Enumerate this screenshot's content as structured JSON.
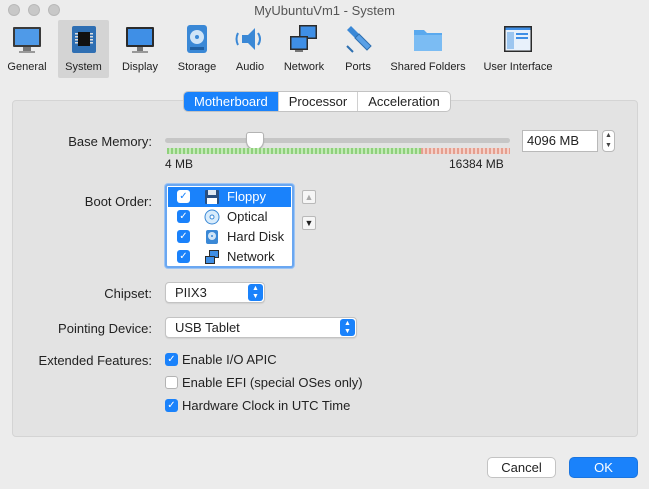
{
  "window": {
    "title": "MyUbuntuVm1 - System"
  },
  "toolbar": {
    "items": [
      {
        "label": "General",
        "icon": "general-icon"
      },
      {
        "label": "System",
        "icon": "system-icon"
      },
      {
        "label": "Display",
        "icon": "display-icon"
      },
      {
        "label": "Storage",
        "icon": "storage-icon"
      },
      {
        "label": "Audio",
        "icon": "audio-icon"
      },
      {
        "label": "Network",
        "icon": "network-icon"
      },
      {
        "label": "Ports",
        "icon": "ports-icon"
      },
      {
        "label": "Shared Folders",
        "icon": "shared-folders-icon"
      },
      {
        "label": "User Interface",
        "icon": "user-interface-icon"
      }
    ],
    "selected": "System"
  },
  "tabs": [
    {
      "label": "Motherboard",
      "active": true
    },
    {
      "label": "Processor",
      "active": false
    },
    {
      "label": "Acceleration",
      "active": false
    }
  ],
  "motherboard": {
    "base_memory": {
      "label": "Base Memory:",
      "min_label": "4 MB",
      "max_label": "16384 MB",
      "value": "4096 MB",
      "slider_fraction": 0.25
    },
    "boot_order": {
      "label": "Boot Order:",
      "items": [
        {
          "label": "Floppy",
          "checked": true,
          "selected": true,
          "icon": "floppy-icon"
        },
        {
          "label": "Optical",
          "checked": true,
          "selected": false,
          "icon": "optical-disc-icon"
        },
        {
          "label": "Hard Disk",
          "checked": true,
          "selected": false,
          "icon": "hard-disk-icon"
        },
        {
          "label": "Network",
          "checked": true,
          "selected": false,
          "icon": "network-adapter-icon"
        }
      ]
    },
    "chipset": {
      "label": "Chipset:",
      "value": "PIIX3"
    },
    "pointing_device": {
      "label": "Pointing Device:",
      "value": "USB Tablet"
    },
    "extended_features": {
      "label": "Extended Features:",
      "options": [
        {
          "label": "Enable I/O APIC",
          "checked": true
        },
        {
          "label": "Enable EFI (special OSes only)",
          "checked": false
        },
        {
          "label": "Hardware Clock in UTC Time",
          "checked": true
        }
      ]
    }
  },
  "buttons": {
    "cancel": "Cancel",
    "ok": "OK"
  },
  "colors": {
    "accent": "#1a82fb",
    "panel": "#e3e3e3",
    "window": "#ececec"
  }
}
